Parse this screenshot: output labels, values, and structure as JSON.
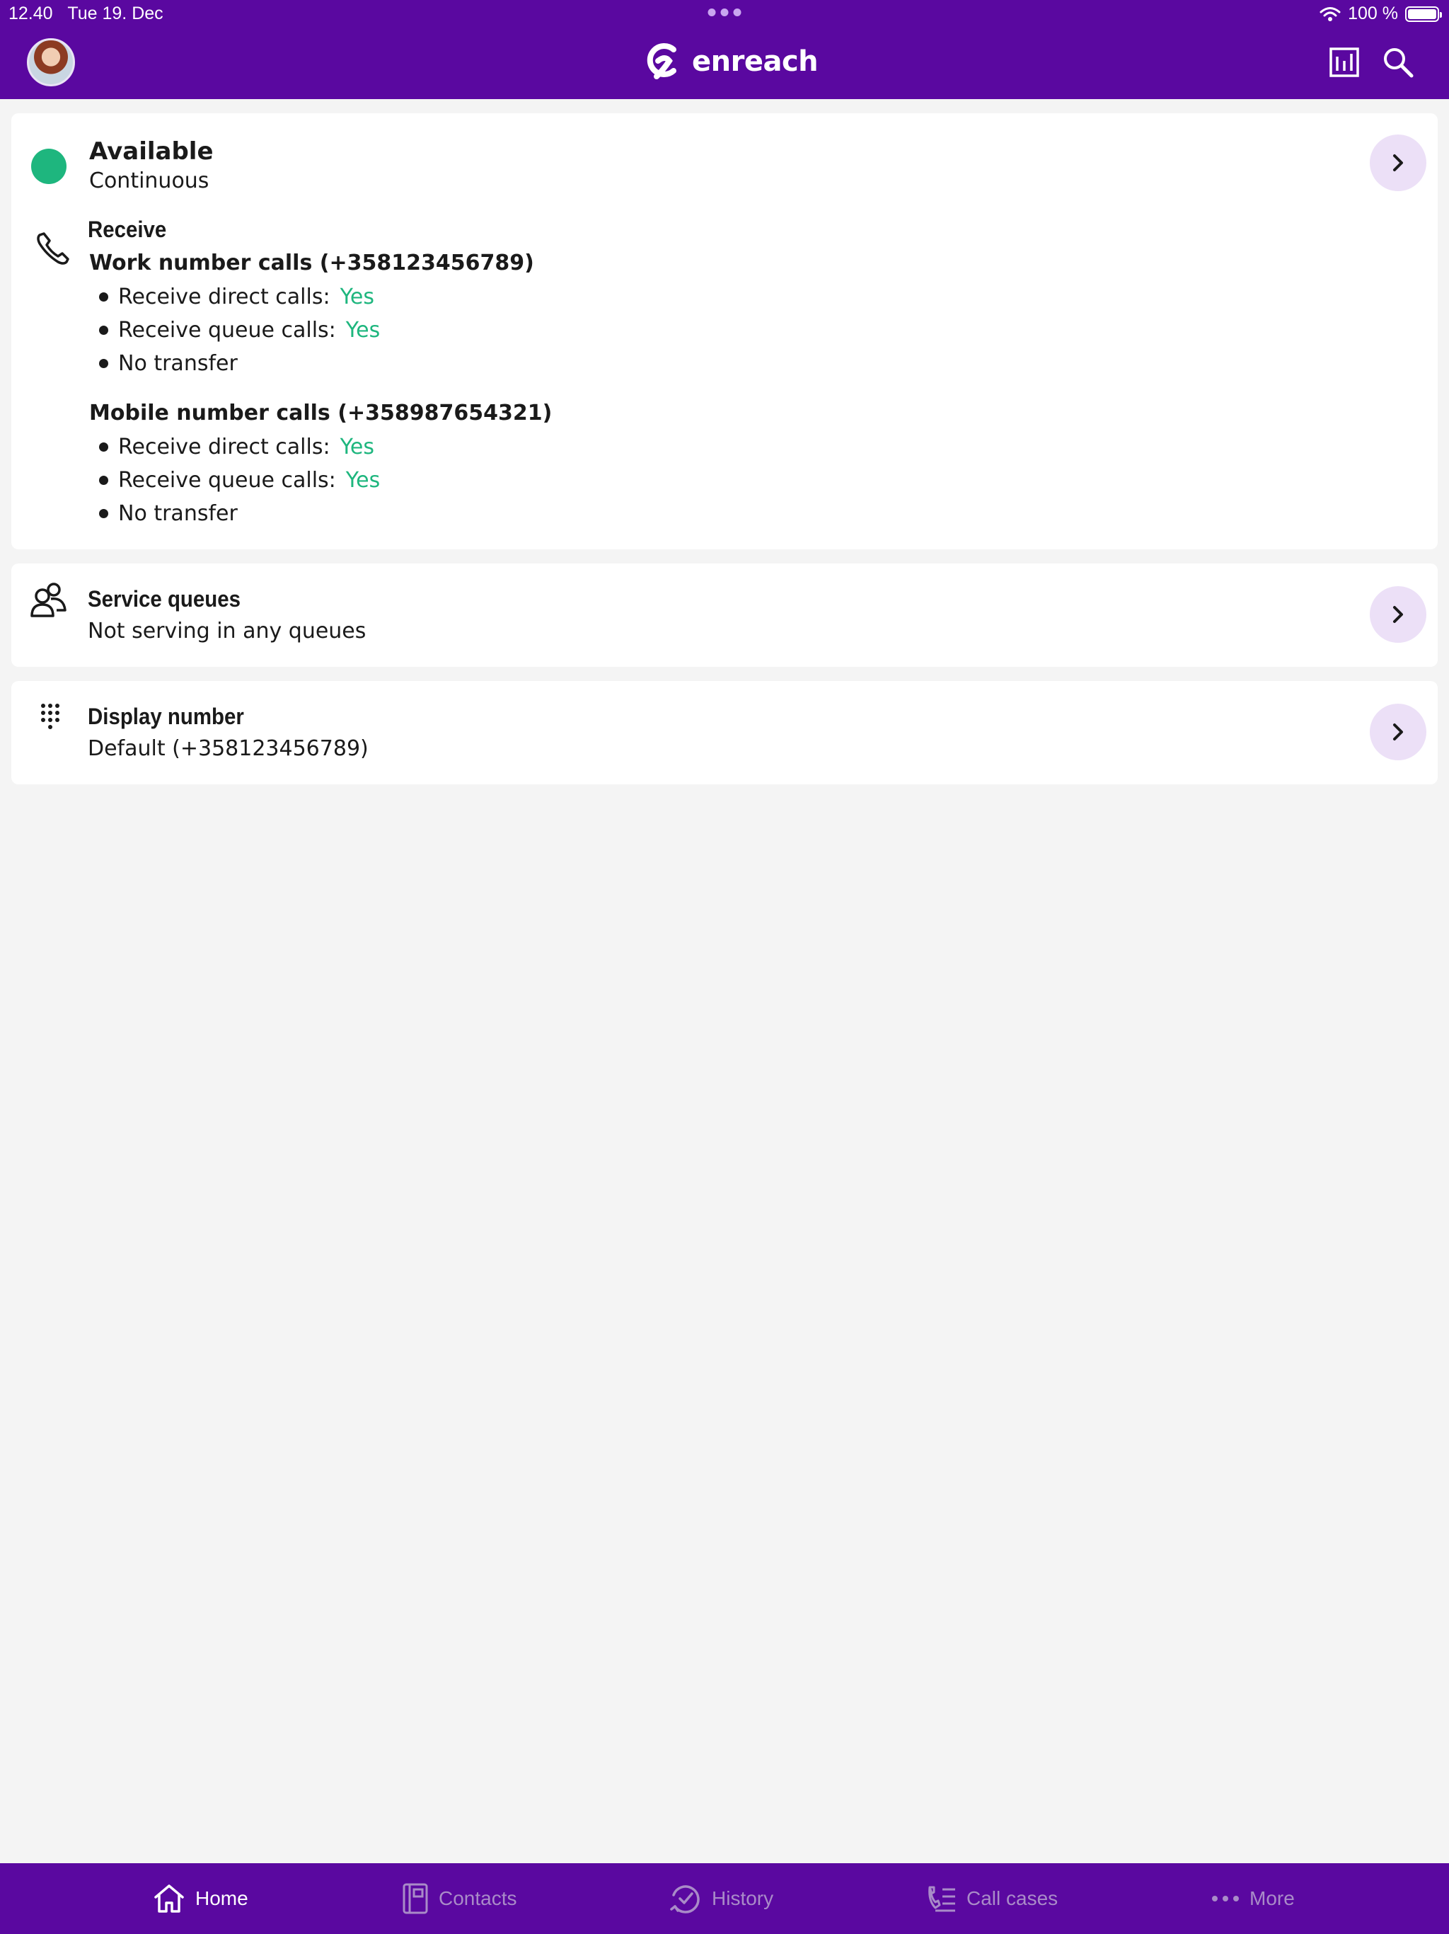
{
  "status_bar": {
    "time": "12.40",
    "date": "Tue 19. Dec",
    "battery": "100 %",
    "battery_level": 1.0
  },
  "header": {
    "logo_text": "enreach",
    "icons": [
      "avatar",
      "stats-icon",
      "search-icon"
    ]
  },
  "availability": {
    "status": "Available",
    "duration": "Continuous",
    "status_color": "#1eb67e"
  },
  "receive": {
    "title": "Receive",
    "work": {
      "label": "Work number calls",
      "number": "(+358123456789)",
      "direct_label": "Receive direct calls:",
      "direct_value": "Yes",
      "queue_label": "Receive queue calls:",
      "queue_value": "Yes",
      "transfer": "No transfer"
    },
    "mobile": {
      "label": "Mobile number calls",
      "number": "(+358987654321)",
      "direct_label": "Receive direct calls:",
      "direct_value": "Yes",
      "queue_label": "Receive queue calls:",
      "queue_value": "Yes",
      "transfer": "No transfer"
    }
  },
  "service_queues": {
    "title": "Service queues",
    "value": "Not serving in any queues"
  },
  "display_number": {
    "title": "Display number",
    "value": "Default (+358123456789)"
  },
  "nav": {
    "items": [
      {
        "label": "Home",
        "icon": "home-icon",
        "active": true
      },
      {
        "label": "Contacts",
        "icon": "contacts-icon",
        "active": false
      },
      {
        "label": "History",
        "icon": "history-icon",
        "active": false
      },
      {
        "label": "Call cases",
        "icon": "call-cases-icon",
        "active": false
      },
      {
        "label": "More",
        "icon": "more-icon",
        "active": false
      }
    ]
  },
  "colors": {
    "brand": "#5a08a0",
    "accent_green": "#1eb67e",
    "chevron_bg": "#ece0f7",
    "nav_inactive": "#a98bc8"
  }
}
